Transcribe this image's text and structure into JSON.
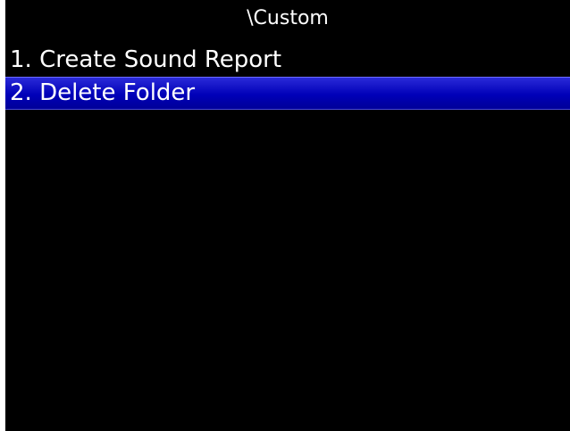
{
  "header": {
    "title": "\\Custom"
  },
  "menu": {
    "items": [
      {
        "label": "1. Create Sound Report",
        "selected": false
      },
      {
        "label": "2. Delete Folder",
        "selected": true
      }
    ]
  },
  "colors": {
    "background": "#000000",
    "text": "#ffffff",
    "selection": "#0000c0"
  }
}
